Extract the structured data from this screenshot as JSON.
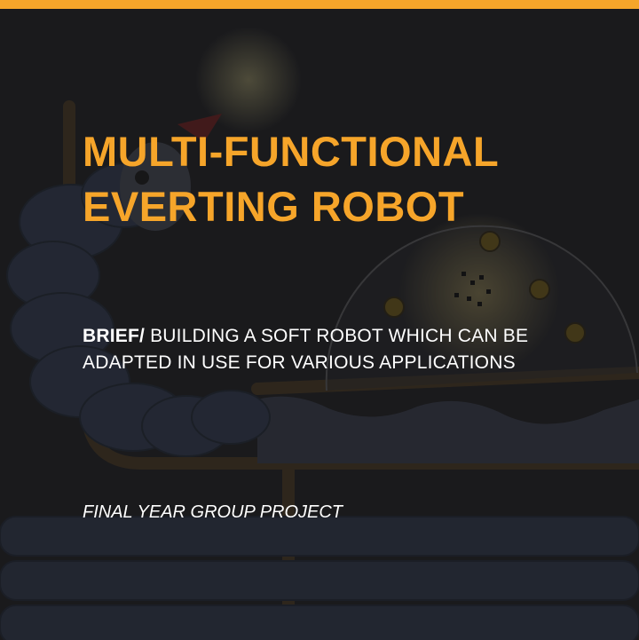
{
  "colors": {
    "accent": "#f6a52a",
    "background": "#1e1e20",
    "text": "#ffffff"
  },
  "title": {
    "line1": "MULTI-FUNCTIONAL",
    "line2": "EVERTING ROBOT"
  },
  "brief": {
    "label": "BRIEF/",
    "line1": "BUILDING A SOFT ROBOT WHICH CAN BE",
    "line2": "ADAPTED IN USE FOR VARIOUS APPLICATIONS"
  },
  "footer": {
    "note": "FINAL YEAR GROUP PROJECT"
  },
  "illustration": {
    "icons": [
      "biohazard-icon",
      "biohazard-icon",
      "biohazard-icon",
      "biohazard-icon",
      "robot-head-icon"
    ]
  }
}
